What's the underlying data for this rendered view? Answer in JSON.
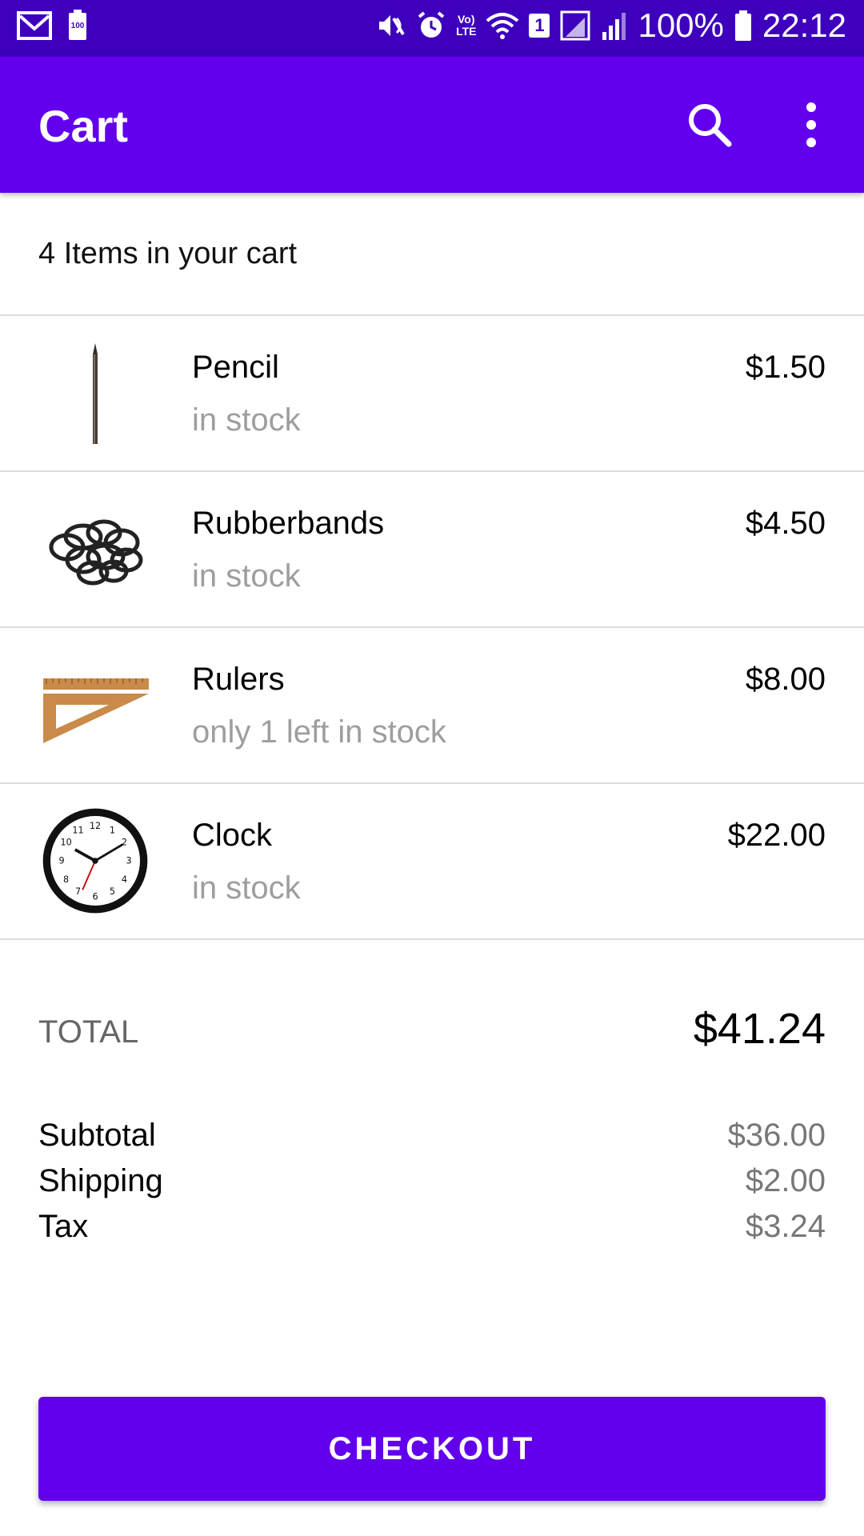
{
  "status_bar": {
    "battery": "100%",
    "time": "22:12",
    "notification_badge": "100",
    "sim_slot": "1",
    "network_label": "LTE"
  },
  "app_bar": {
    "title": "Cart",
    "actions": [
      "search-icon",
      "more-vert-icon"
    ]
  },
  "cart": {
    "count_text": "4 Items in your cart",
    "items": [
      {
        "name": "Pencil",
        "stock": "in stock",
        "price": "$1.50",
        "icon": "pencil-image"
      },
      {
        "name": "Rubberbands",
        "stock": "in stock",
        "price": "$4.50",
        "icon": "rubberbands-image"
      },
      {
        "name": "Rulers",
        "stock": "only 1 left in stock",
        "price": "$8.00",
        "icon": "rulers-image"
      },
      {
        "name": "Clock",
        "stock": "in stock",
        "price": "$22.00",
        "icon": "clock-image"
      }
    ]
  },
  "totals": {
    "total_label": "TOTAL",
    "total_value": "$41.24",
    "subtotal_label": "Subtotal",
    "subtotal_value": "$36.00",
    "shipping_label": "Shipping",
    "shipping_value": "$2.00",
    "tax_label": "Tax",
    "tax_value": "$3.24"
  },
  "checkout_label": "CHECKOUT",
  "colors": {
    "status_bar": "#3e00bd",
    "primary": "#6200ee",
    "secondary_text": "#9e9e9e"
  }
}
